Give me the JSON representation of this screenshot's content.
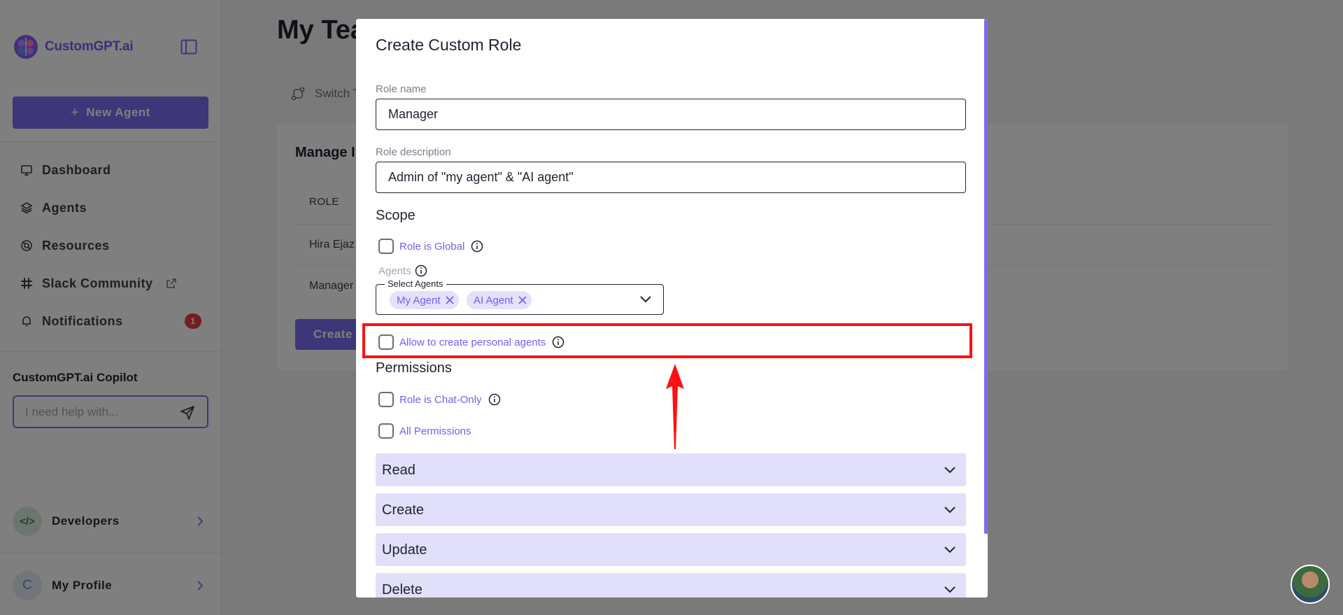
{
  "sidebar": {
    "logo_text": "CustomGPT.ai",
    "new_agent_label": "New Agent",
    "nav": [
      {
        "label": "Dashboard",
        "icon": "monitor-icon"
      },
      {
        "label": "Agents",
        "icon": "layers-icon"
      },
      {
        "label": "Resources",
        "icon": "lifebuoy-icon"
      },
      {
        "label": "Slack Community",
        "icon": "slack-icon"
      },
      {
        "label": "Notifications",
        "icon": "bell-icon",
        "badge": "1"
      }
    ],
    "copilot_title": "CustomGPT.ai Copilot",
    "copilot_placeholder": "I need help with...",
    "developers_label": "Developers",
    "developers_avatar": "</>",
    "profile_label": "My Profile",
    "profile_initial": "C"
  },
  "main": {
    "title": "My Tea",
    "switch_label": "Switch T",
    "card_title": "Manage I",
    "column_role": "ROLE",
    "rows": [
      "Hira Ejaz",
      "Manager"
    ],
    "create_label": "Create"
  },
  "modal": {
    "title": "Create Custom Role",
    "role_name_label": "Role name",
    "role_name_value": "Manager",
    "role_description_label": "Role description",
    "role_description_value": "Admin of \"my agent\" & \"AI agent\"",
    "scope_heading": "Scope",
    "role_is_global_label": "Role is Global",
    "agents_label": "Agents",
    "select_agents_legend": "Select Agents",
    "selected_agents": [
      "My Agent",
      "AI Agent"
    ],
    "allow_personal_label": "Allow to create personal agents",
    "permissions_heading": "Permissions",
    "chat_only_label": "Role is Chat-Only",
    "all_permissions_label": "All Permissions",
    "sections": [
      "Read",
      "Create",
      "Update",
      "Delete"
    ]
  },
  "colors": {
    "accent": "#7B6CF0",
    "accordion_bg": "#e2dffb",
    "highlight": "#ff1010",
    "badge": "#e53e3e"
  }
}
